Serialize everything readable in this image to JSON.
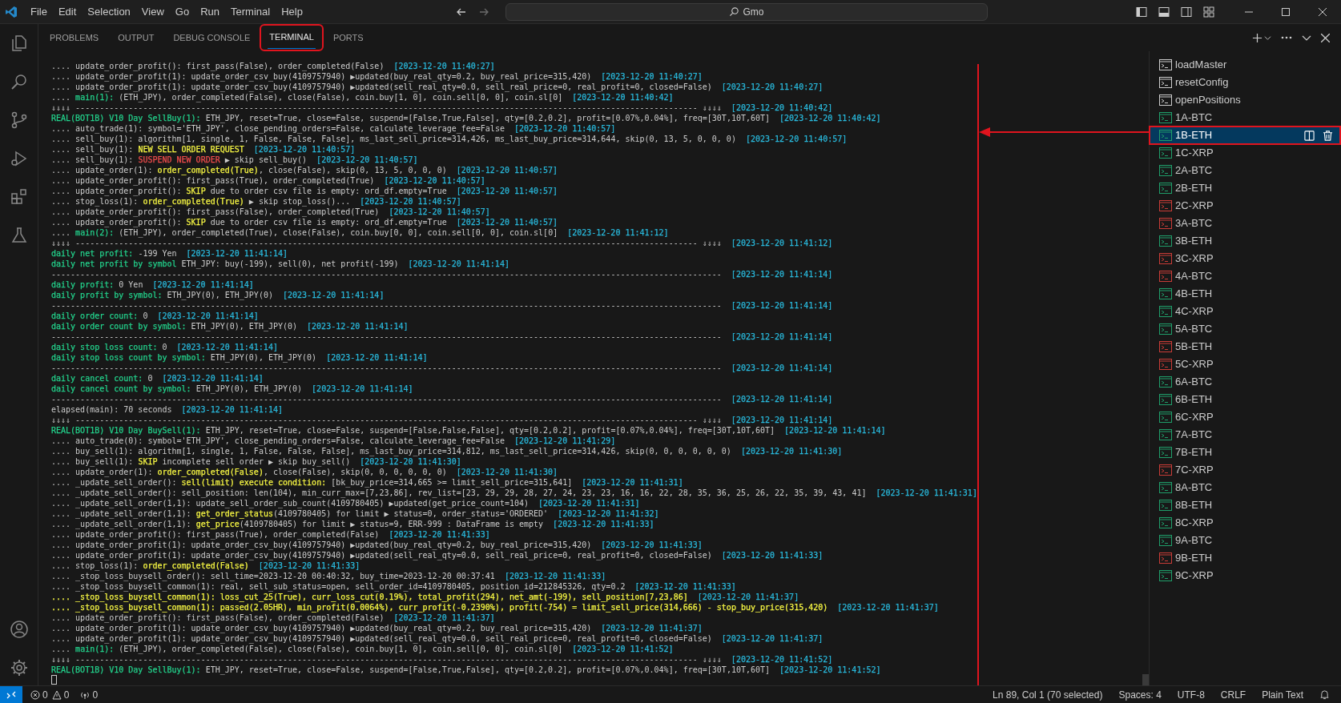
{
  "window": {
    "title": "Gmo"
  },
  "menu": [
    "File",
    "Edit",
    "Selection",
    "View",
    "Go",
    "Run",
    "Terminal",
    "Help"
  ],
  "panel_tabs": [
    {
      "label": "PROBLEMS",
      "selected": false
    },
    {
      "label": "OUTPUT",
      "selected": false
    },
    {
      "label": "DEBUG CONSOLE",
      "selected": false
    },
    {
      "label": "TERMINAL",
      "selected": true
    },
    {
      "label": "PORTS",
      "selected": false
    }
  ],
  "terminal_lines": [
    [
      ".... update_order_profit(): first_pass(False), order_completed(False)",
      {
        "text": "[2023-12-20 11:40:27]",
        "color": "#29b8db"
      }
    ],
    [
      ".... update_order_profit(1): update_order_csv_buy(4109757940) ▶updated(buy_real_qty=0.2, buy_real_price=315,420)",
      {
        "text": "[2023-12-20 11:40:27]",
        "color": "#29b8db"
      }
    ],
    [
      ".... update_order_profit(1): update_order_csv_buy(4109757940) ▶updated(sell_real_qty=0.0, sell_real_price=0, real_profit=0, closed=False)",
      {
        "text": "[2023-12-20 11:40:27]",
        "color": "#29b8db"
      }
    ],
    [
      ".... ",
      {
        "text": "main(1):",
        "color": "#23d18b"
      },
      " (ETH_JPY), order_completed(False), close(False), coin.buy[1, 0], coin.sell[0, 0], coin.sl[0]",
      {
        "text": "[2023-12-20 11:40:42]",
        "color": "#29b8db"
      }
    ],
    [
      "⇓⇓⇓⇓ --------------------------------------------------------------------------------------------------------------------------------- ⇓⇓⇓⇓",
      {
        "text": "[2023-12-20 11:40:42]",
        "color": "#29b8db"
      }
    ],
    [
      {
        "text": "REAL(BOT1B) V10 Day SellBuy(1):",
        "color": "#23d18b"
      },
      " ETH_JPY, reset=True, close=False, suspend=[False,True,False], qty=[0.2,0.2], profit=[0.07%,0.04%], freq=[30T,10T,60T]",
      {
        "text": "[2023-12-20 11:40:42]",
        "color": "#29b8db"
      }
    ],
    [
      ".... auto_trade(1): symbol='ETH_JPY', close_pending_orders=False, calculate_leverage_fee=False",
      {
        "text": "[2023-12-20 11:40:57]",
        "color": "#29b8db"
      }
    ],
    [
      ".... sell_buy(1): algorithm[1, single, 1, False, False, False], ms_last_sell_price=314,426, ms_last_buy_price=314,644, skip(0, 13, 5, 0, 0, 0)",
      {
        "text": "[2023-12-20 11:40:57]",
        "color": "#29b8db"
      }
    ],
    [
      ".... sell_buy(1): ",
      {
        "text": "NEW SELL ORDER REQUEST",
        "color": "#f5f543"
      },
      {
        "text": "[2023-12-20 11:40:57]",
        "color": "#29b8db"
      }
    ],
    [
      ".... sell_buy(1): ",
      {
        "text": "SUSPEND NEW ORDER",
        "color": "#f14c4c"
      },
      " ▶ skip sell_buy()",
      {
        "text": "[2023-12-20 11:40:57]",
        "color": "#29b8db"
      }
    ],
    [
      ".... update_order(1): ",
      {
        "text": "order_completed(True)",
        "color": "#f5f543"
      },
      ", close(False), skip(0, 13, 5, 0, 0, 0)",
      {
        "text": "[2023-12-20 11:40:57]",
        "color": "#29b8db"
      }
    ],
    [
      ".... update_order_profit(): first_pass(True), order_completed(True)",
      {
        "text": "[2023-12-20 11:40:57]",
        "color": "#29b8db"
      }
    ],
    [
      ".... update_order_profit(): ",
      {
        "text": "SKIP",
        "color": "#f5f543"
      },
      " due to order csv file is empty: ord_df.empty=True",
      {
        "text": "[2023-12-20 11:40:57]",
        "color": "#29b8db"
      }
    ],
    [
      ".... stop_loss(1): ",
      {
        "text": "order_completed(True)",
        "color": "#f5f543"
      },
      " ▶ skip stop_loss()...",
      {
        "text": "[2023-12-20 11:40:57]",
        "color": "#29b8db"
      }
    ],
    [
      ".... update_order_profit(): first_pass(False), order_completed(True)",
      {
        "text": "[2023-12-20 11:40:57]",
        "color": "#29b8db"
      }
    ],
    [
      ".... update_order_profit(): ",
      {
        "text": "SKIP",
        "color": "#f5f543"
      },
      " due to order csv file is empty: ord_df.empty=True",
      {
        "text": "[2023-12-20 11:40:57]",
        "color": "#29b8db"
      }
    ],
    [
      ".... ",
      {
        "text": "main(2):",
        "color": "#23d18b"
      },
      " (ETH_JPY), order_completed(True), close(False), coin.buy[0, 0], coin.sell[0, 0], coin.sl[0]",
      {
        "text": "[2023-12-20 11:41:12]",
        "color": "#29b8db"
      }
    ],
    [
      "⇓⇓⇓⇓ --------------------------------------------------------------------------------------------------------------------------------- ⇓⇓⇓⇓",
      {
        "text": "[2023-12-20 11:41:12]",
        "color": "#29b8db"
      }
    ],
    [
      {
        "text": "daily net profit:",
        "color": "#23d18b"
      },
      " -199 Yen",
      {
        "text": "[2023-12-20 11:41:14]",
        "color": "#29b8db"
      }
    ],
    [
      {
        "text": "daily net profit by symbol",
        "color": "#23d18b"
      },
      " ETH_JPY: buy(-199), sell(0), net profit(-199)",
      {
        "text": "[2023-12-20 11:41:14]",
        "color": "#29b8db"
      }
    ],
    [
      "-------------------------------------------------------------------------------------------------------------------------------------------",
      {
        "text": "[2023-12-20 11:41:14]",
        "color": "#29b8db"
      }
    ],
    [
      {
        "text": "daily profit:",
        "color": "#23d18b"
      },
      " 0 Yen",
      {
        "text": "[2023-12-20 11:41:14]",
        "color": "#29b8db"
      }
    ],
    [
      {
        "text": "daily profit by symbol:",
        "color": "#23d18b"
      },
      " ETH_JPY(0), ETH_JPY(0)",
      {
        "text": "[2023-12-20 11:41:14]",
        "color": "#29b8db"
      }
    ],
    [
      "-------------------------------------------------------------------------------------------------------------------------------------------",
      {
        "text": "[2023-12-20 11:41:14]",
        "color": "#29b8db"
      }
    ],
    [
      {
        "text": "daily order count:",
        "color": "#23d18b"
      },
      " 0",
      {
        "text": "[2023-12-20 11:41:14]",
        "color": "#29b8db"
      }
    ],
    [
      {
        "text": "daily order count by symbol:",
        "color": "#23d18b"
      },
      " ETH_JPY(0), ETH_JPY(0)",
      {
        "text": "[2023-12-20 11:41:14]",
        "color": "#29b8db"
      }
    ],
    [
      "-------------------------------------------------------------------------------------------------------------------------------------------",
      {
        "text": "[2023-12-20 11:41:14]",
        "color": "#29b8db"
      }
    ],
    [
      {
        "text": "daily stop loss count:",
        "color": "#23d18b"
      },
      " 0",
      {
        "text": "[2023-12-20 11:41:14]",
        "color": "#29b8db"
      }
    ],
    [
      {
        "text": "daily stop loss count by symbol:",
        "color": "#23d18b"
      },
      " ETH_JPY(0), ETH_JPY(0)",
      {
        "text": "[2023-12-20 11:41:14]",
        "color": "#29b8db"
      }
    ],
    [
      "-------------------------------------------------------------------------------------------------------------------------------------------",
      {
        "text": "[2023-12-20 11:41:14]",
        "color": "#29b8db"
      }
    ],
    [
      {
        "text": "daily cancel count:",
        "color": "#23d18b"
      },
      " 0",
      {
        "text": "[2023-12-20 11:41:14]",
        "color": "#29b8db"
      }
    ],
    [
      {
        "text": "daily cancel count by symbol:",
        "color": "#23d18b"
      },
      " ETH_JPY(0), ETH_JPY(0)",
      {
        "text": "[2023-12-20 11:41:14]",
        "color": "#29b8db"
      }
    ],
    [
      "-------------------------------------------------------------------------------------------------------------------------------------------",
      {
        "text": "[2023-12-20 11:41:14]",
        "color": "#29b8db"
      }
    ],
    [
      "elapsed(main): 70 seconds",
      {
        "text": "[2023-12-20 11:41:14]",
        "color": "#29b8db"
      }
    ],
    [
      "⇓⇓⇓⇓ --------------------------------------------------------------------------------------------------------------------------------- ⇓⇓⇓⇓",
      {
        "text": "[2023-12-20 11:41:14]",
        "color": "#29b8db"
      }
    ],
    [
      {
        "text": "REAL(BOT1B) V10 Day BuySell(1):",
        "color": "#23d18b"
      },
      " ETH_JPY, reset=True, close=False, suspend=[False,False,False], qty=[0.2,0.2], profit=[0.07%,0.04%], freq=[30T,10T,60T]",
      {
        "text": "[2023-12-20 11:41:14]",
        "color": "#29b8db"
      }
    ],
    [
      ".... auto_trade(0): symbol='ETH_JPY', close_pending_orders=False, calculate_leverage_fee=False",
      {
        "text": "[2023-12-20 11:41:29]",
        "color": "#29b8db"
      }
    ],
    [
      ".... buy_sell(1): algorithm[1, single, 1, False, False, False], ms_last_buy_price=314,812, ms_last_sell_price=314,426, skip(0, 0, 0, 0, 0, 0)",
      {
        "text": "[2023-12-20 11:41:30]",
        "color": "#29b8db"
      }
    ],
    [
      ".... buy_sell(1): ",
      {
        "text": "SKIP",
        "color": "#f5f543"
      },
      " incomplete sell order ▶ skip buy_sell()",
      {
        "text": "[2023-12-20 11:41:30]",
        "color": "#29b8db"
      }
    ],
    [
      ".... update_order(1): ",
      {
        "text": "order_completed(False)",
        "color": "#f5f543"
      },
      ", close(False), skip(0, 0, 0, 0, 0, 0)",
      {
        "text": "[2023-12-20 11:41:30]",
        "color": "#29b8db"
      }
    ],
    [
      ".... _update_sell_order(): ",
      {
        "text": "sell(limit) execute condition:",
        "color": "#f5f543"
      },
      " [bk_buy_price=314,665 >= limit_sell_price=315,641]",
      {
        "text": "[2023-12-20 11:41:31]",
        "color": "#29b8db"
      }
    ],
    [
      ".... _update_sell_order(): sell_position: len(104), min_curr_max=[7,23,86], rev_list=[23, 29, 29, 28, 27, 24, 23, 23, 16, 16, 22, 28, 35, 36, 25, 26, 22, 35, 39, 43, 41]",
      {
        "text": "[2023-12-20 11:41:31]",
        "color": "#29b8db"
      }
    ],
    [
      ".... _update_sell_order(1,1): update_sell_order_sub_count(4109780405) ▶updated(get_price_count=104)",
      {
        "text": "[2023-12-20 11:41:31]",
        "color": "#29b8db"
      }
    ],
    [
      ".... _update_sell_order(1,1): ",
      {
        "text": "get_order_status",
        "color": "#f5f543"
      },
      "(4109780405) for limit ▶ status=0, order_status='ORDERED'",
      {
        "text": "[2023-12-20 11:41:32]",
        "color": "#29b8db"
      }
    ],
    [
      ".... _update_sell_order(1,1): ",
      {
        "text": "get_price",
        "color": "#f5f543"
      },
      "(4109780405) for limit ▶ status=9, ERR-999 : DataFrame is empty",
      {
        "text": "[2023-12-20 11:41:33]",
        "color": "#29b8db"
      }
    ],
    [
      ".... update_order_profit(): first_pass(True), order_completed(False)",
      {
        "text": "[2023-12-20 11:41:33]",
        "color": "#29b8db"
      }
    ],
    [
      ".... update_order_profit(1): update_order_csv_buy(4109757940) ▶updated(buy_real_qty=0.2, buy_real_price=315,420)",
      {
        "text": "[2023-12-20 11:41:33]",
        "color": "#29b8db"
      }
    ],
    [
      ".... update_order_profit(1): update_order_csv_buy(4109757940) ▶updated(sell_real_qty=0.0, sell_real_price=0, real_profit=0, closed=False)",
      {
        "text": "[2023-12-20 11:41:33]",
        "color": "#29b8db"
      }
    ],
    [
      ".... stop_loss(1): ",
      {
        "text": "order_completed(False)",
        "color": "#f5f543"
      },
      {
        "text": "[2023-12-20 11:41:33]",
        "color": "#29b8db"
      }
    ],
    [
      ".... _stop_loss_buysell_order(): sell_time=2023-12-20 00:40:32, buy_time=2023-12-20 00:37:41",
      {
        "text": "[2023-12-20 11:41:33]",
        "color": "#29b8db"
      }
    ],
    [
      ".... _stop_loss_buysell_common(1): real, sell_sub_status=open, sell_order_id=4109780405, position_id=212845326, qty=0.2",
      {
        "text": "[2023-12-20 11:41:33]",
        "color": "#29b8db"
      }
    ],
    [
      {
        "text": ".... _stop_loss_buysell_common(1): loss_cut_25(True), curr_loss_cut(0.19%), total_profit(294), net_amt(-199), sell_position[7,23,86]",
        "color": "#f5f543"
      },
      {
        "text": "[2023-12-20 11:41:37]",
        "color": "#29b8db"
      }
    ],
    [
      {
        "text": ".... _stop_loss_buysell_common(1): passed(2.05HR), min_profit(0.0064%), curr_profit(-0.2390%), profit(-754) = limit_sell_price(314,666) - stop_buy_price(315,420)",
        "color": "#f5f543"
      },
      {
        "text": "[2023-12-20 11:41:37]",
        "color": "#29b8db"
      }
    ],
    [
      ".... update_order_profit(): first_pass(False), order_completed(False)",
      {
        "text": "[2023-12-20 11:41:37]",
        "color": "#29b8db"
      }
    ],
    [
      ".... update_order_profit(1): update_order_csv_buy(4109757940) ▶updated(buy_real_qty=0.2, buy_real_price=315,420)",
      {
        "text": "[2023-12-20 11:41:37]",
        "color": "#29b8db"
      }
    ],
    [
      ".... update_order_profit(1): update_order_csv_buy(4109757940) ▶updated(sell_real_qty=0.0, sell_real_price=0, real_profit=0, closed=False)",
      {
        "text": "[2023-12-20 11:41:37]",
        "color": "#29b8db"
      }
    ],
    [
      ".... ",
      {
        "text": "main(1):",
        "color": "#23d18b"
      },
      " (ETH_JPY), order_completed(False), close(False), coin.buy[1, 0], coin.sell[0, 0], coin.sl[0]",
      {
        "text": "[2023-12-20 11:41:52]",
        "color": "#29b8db"
      }
    ],
    [
      "⇓⇓⇓⇓ --------------------------------------------------------------------------------------------------------------------------------- ⇓⇓⇓⇓",
      {
        "text": "[2023-12-20 11:41:52]",
        "color": "#29b8db"
      }
    ],
    [
      {
        "text": "REAL(BOT1B) V10 Day SellBuy(1):",
        "color": "#23d18b"
      },
      " ETH_JPY, reset=True, close=False, suspend=[False,True,False], qty=[0.2,0.2], profit=[0.07%,0.04%], freq=[30T,10T,60T]",
      {
        "text": "[2023-12-20 11:41:52]",
        "color": "#29b8db"
      }
    ]
  ],
  "terminals": [
    {
      "label": "loadMaster",
      "color": "#cccccc",
      "selected": false
    },
    {
      "label": "resetConfig",
      "color": "#cccccc",
      "selected": false
    },
    {
      "label": "openPositions",
      "color": "#cccccc",
      "selected": false
    },
    {
      "label": "1A-BTC",
      "color": "#1f9e6a",
      "selected": false
    },
    {
      "label": "1B-ETH",
      "color": "#1f9e6a",
      "selected": true
    },
    {
      "label": "1C-XRP",
      "color": "#1f9e6a",
      "selected": false
    },
    {
      "label": "2A-BTC",
      "color": "#1f9e6a",
      "selected": false
    },
    {
      "label": "2B-ETH",
      "color": "#1f9e6a",
      "selected": false
    },
    {
      "label": "2C-XRP",
      "color": "#c93c37",
      "selected": false
    },
    {
      "label": "3A-BTC",
      "color": "#c93c37",
      "selected": false
    },
    {
      "label": "3B-ETH",
      "color": "#1f9e6a",
      "selected": false
    },
    {
      "label": "3C-XRP",
      "color": "#c93c37",
      "selected": false
    },
    {
      "label": "4A-BTC",
      "color": "#c93c37",
      "selected": false
    },
    {
      "label": "4B-ETH",
      "color": "#1f9e6a",
      "selected": false
    },
    {
      "label": "4C-XRP",
      "color": "#1f9e6a",
      "selected": false
    },
    {
      "label": "5A-BTC",
      "color": "#1f9e6a",
      "selected": false
    },
    {
      "label": "5B-ETH",
      "color": "#c93c37",
      "selected": false
    },
    {
      "label": "5C-XRP",
      "color": "#c93c37",
      "selected": false
    },
    {
      "label": "6A-BTC",
      "color": "#1f9e6a",
      "selected": false
    },
    {
      "label": "6B-ETH",
      "color": "#1f9e6a",
      "selected": false
    },
    {
      "label": "6C-XRP",
      "color": "#1f9e6a",
      "selected": false
    },
    {
      "label": "7A-BTC",
      "color": "#1f9e6a",
      "selected": false
    },
    {
      "label": "7B-ETH",
      "color": "#1f9e6a",
      "selected": false
    },
    {
      "label": "7C-XRP",
      "color": "#c93c37",
      "selected": false
    },
    {
      "label": "8A-BTC",
      "color": "#1f9e6a",
      "selected": false
    },
    {
      "label": "8B-ETH",
      "color": "#1f9e6a",
      "selected": false
    },
    {
      "label": "8C-XRP",
      "color": "#1f9e6a",
      "selected": false
    },
    {
      "label": "9A-BTC",
      "color": "#1f9e6a",
      "selected": false
    },
    {
      "label": "9B-ETH",
      "color": "#c93c37",
      "selected": false
    },
    {
      "label": "9C-XRP",
      "color": "#1f9e6a",
      "selected": false
    }
  ],
  "status_bar": {
    "errors": "0",
    "warnings": "0",
    "ports": "0",
    "cursor": "Ln 89, Col 1 (70 selected)",
    "spaces": "Spaces: 4",
    "encoding": "UTF-8",
    "eol": "CRLF",
    "language": "Plain Text"
  }
}
